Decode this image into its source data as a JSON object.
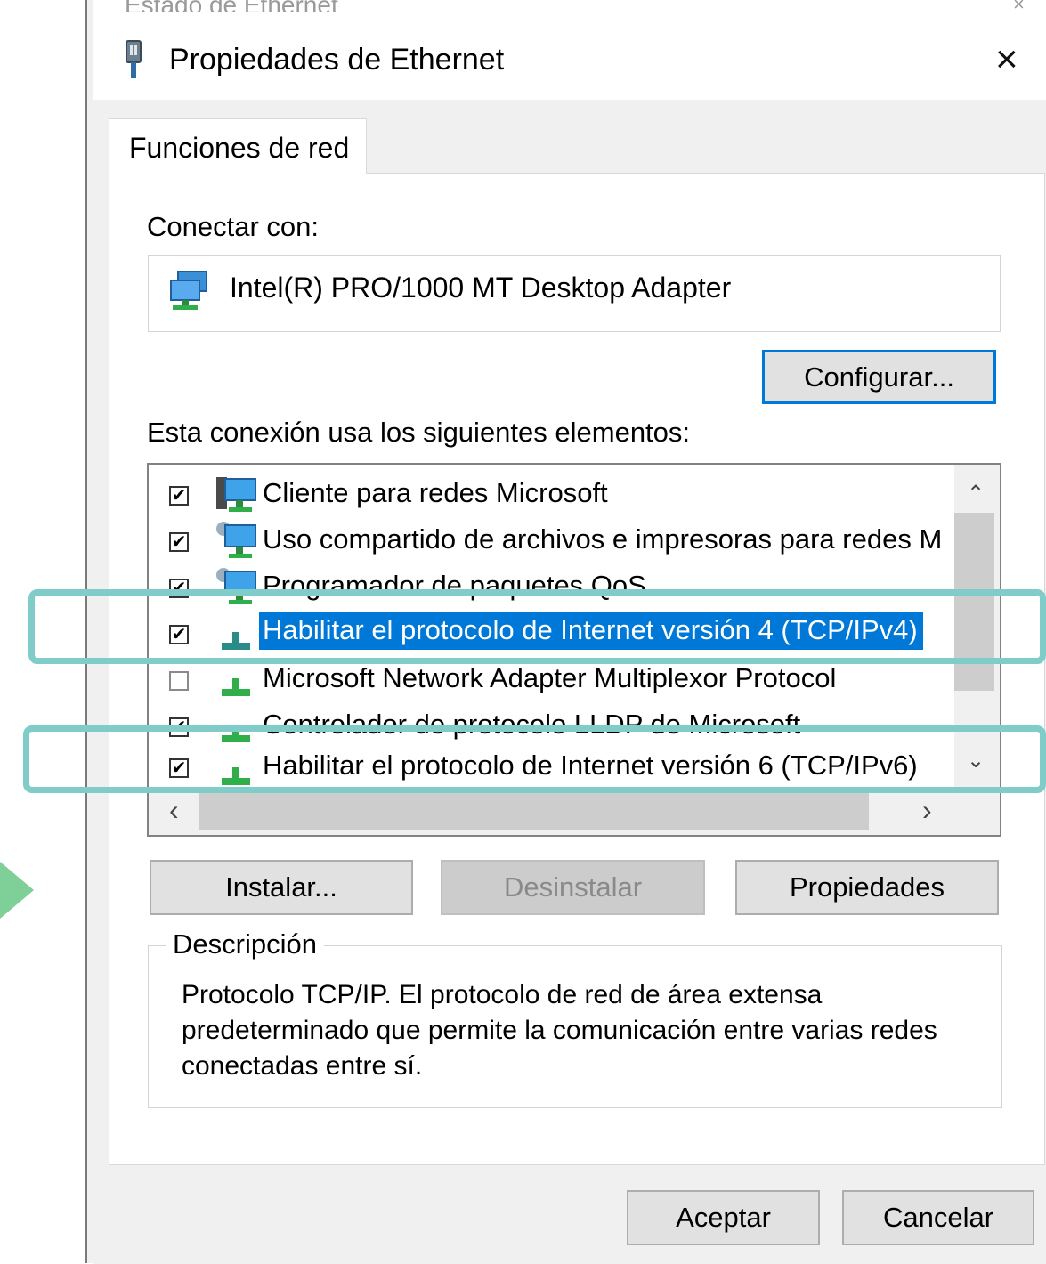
{
  "background_window": {
    "title": "Estado de Ethernet",
    "close": "×"
  },
  "dialog": {
    "title": "Propiedades de Ethernet",
    "close_glyph": "×",
    "tab": "Funciones de red",
    "connect_label": "Conectar con:",
    "adapter_name": "Intel(R) PRO/1000 MT Desktop Adapter",
    "configure_button": "Configurar...",
    "elements_label": "Esta conexión usa los siguientes elementos:",
    "items": [
      {
        "label": "Cliente para redes Microsoft",
        "checked": true,
        "icon": "network-client-icon"
      },
      {
        "label": "Uso compartido de archivos e impresoras para redes M",
        "checked": true,
        "icon": "network-service-icon"
      },
      {
        "label": "Programador de paquetes QoS",
        "checked": true,
        "icon": "network-service-icon"
      },
      {
        "label": "Habilitar el protocolo de Internet versión 4 (TCP/IPv4)",
        "checked": true,
        "selected": true,
        "icon": "protocol-icon"
      },
      {
        "label": "Microsoft Network Adapter Multiplexor Protocol",
        "checked": false,
        "icon": "protocol-icon"
      },
      {
        "label": "Controlador de protocolo LLDP de Microsoft",
        "checked": true,
        "icon": "protocol-icon"
      },
      {
        "label": "Habilitar el protocolo de Internet versión 6 (TCP/IPv6)",
        "checked": true,
        "icon": "protocol-icon"
      }
    ],
    "install_button": "Instalar...",
    "uninstall_button": "Desinstalar",
    "properties_button": "Propiedades",
    "description_legend": "Descripción",
    "description_text": "Protocolo TCP/IP. El protocolo de red de área extensa predeterminado que permite la comunicación entre varias redes conectadas entre sí.",
    "ok_button": "Aceptar",
    "cancel_button": "Cancelar",
    "checkmark": "✔",
    "scroll_up": "⌃",
    "scroll_down": "⌄",
    "scroll_left": "‹",
    "scroll_right": "›"
  },
  "colors": {
    "selection": "#0078d7",
    "highlight_annotation": "#7fccc8",
    "arrow_annotation": "#7fcf99"
  }
}
